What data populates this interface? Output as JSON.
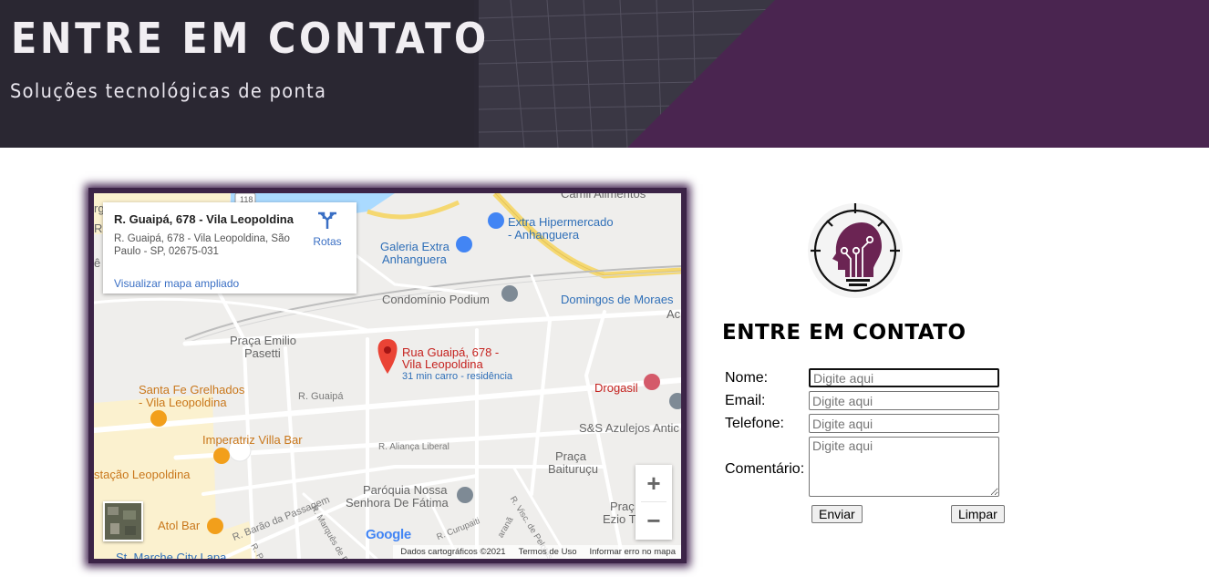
{
  "header": {
    "title": "ENTRE EM CONTATO",
    "subtitle": "Soluções tecnológicas de ponta",
    "accent_color": "#4a2550"
  },
  "map": {
    "info_card": {
      "title": "R. Guaipá, 678 - Vila Leopoldina",
      "address": "R. Guaipá, 678 - Vila Leopoldina, São Paulo - SP, 02675-031",
      "link": "Visualizar mapa ampliado",
      "routes_label": "Rotas"
    },
    "marker": {
      "name_line1": "Rua Guaipá, 678 -",
      "name_line2": "Vila Leopoldina",
      "travel": "31 min carro - residência"
    },
    "places": {
      "extra_line1": "Extra Hipermercado",
      "extra_line2": "- Anhanguera",
      "galeria_line1": "Galeria Extra",
      "galeria_line2": "Anhanguera",
      "podium": "Condomínio Podium",
      "domingos": "Domingos de Moraes",
      "praca_emilio_line1": "Praça Emilio",
      "praca_emilio_line2": "Pasetti",
      "santa_fe_line1": "Santa Fe Grelhados",
      "santa_fe_line2": "- Vila Leopoldina",
      "drogasil": "Drogasil",
      "imperatriz": "Imperatriz Villa Bar",
      "sns": "S&S Azulejos Antic",
      "estacao": "stação Leopoldina",
      "paroquia_line1": "Paróquia Nossa",
      "paroquia_line2": "Senhora De Fátima",
      "praca_baituruçu_line1": "Praça",
      "praca_baituruçu_line2": "Baituruçu",
      "atol": "Atol Bar",
      "praca_ezio_line1": "Praç",
      "praca_ezio_line2": "Ezio T",
      "camil": "Camil Alimentos",
      "ac": "Ac",
      "st_marche": "St. Marche City Lapa",
      "partial_r": "Rio",
      "partial_e": "ê",
      "partial_g": "rg"
    },
    "streets": {
      "guaipa": "R. Guaipá",
      "alianca": "R. Aliança Liberal",
      "barao": "R. Barão da Passagem",
      "marques": "R. Marquês de Pa",
      "curupaiti": "R. Curupaiti",
      "visc": "R. Visc. de Pelotas",
      "passo": "R. Passo",
      "arana": "aranã",
      "route_badge": "118"
    },
    "zoom_in": "+",
    "zoom_out": "−",
    "google": "Google",
    "attribution": {
      "data": "Dados cartográficos ©2021",
      "terms": "Termos de Uso",
      "report": "Informar erro no mapa"
    }
  },
  "contact": {
    "title": "ENTRE EM CONTATO",
    "labels": {
      "name": "Nome:",
      "email": "Email:",
      "phone": "Telefone:",
      "comment": "Comentário:"
    },
    "placeholder": "Digite aqui",
    "submit": "Enviar",
    "reset": "Limpar"
  }
}
